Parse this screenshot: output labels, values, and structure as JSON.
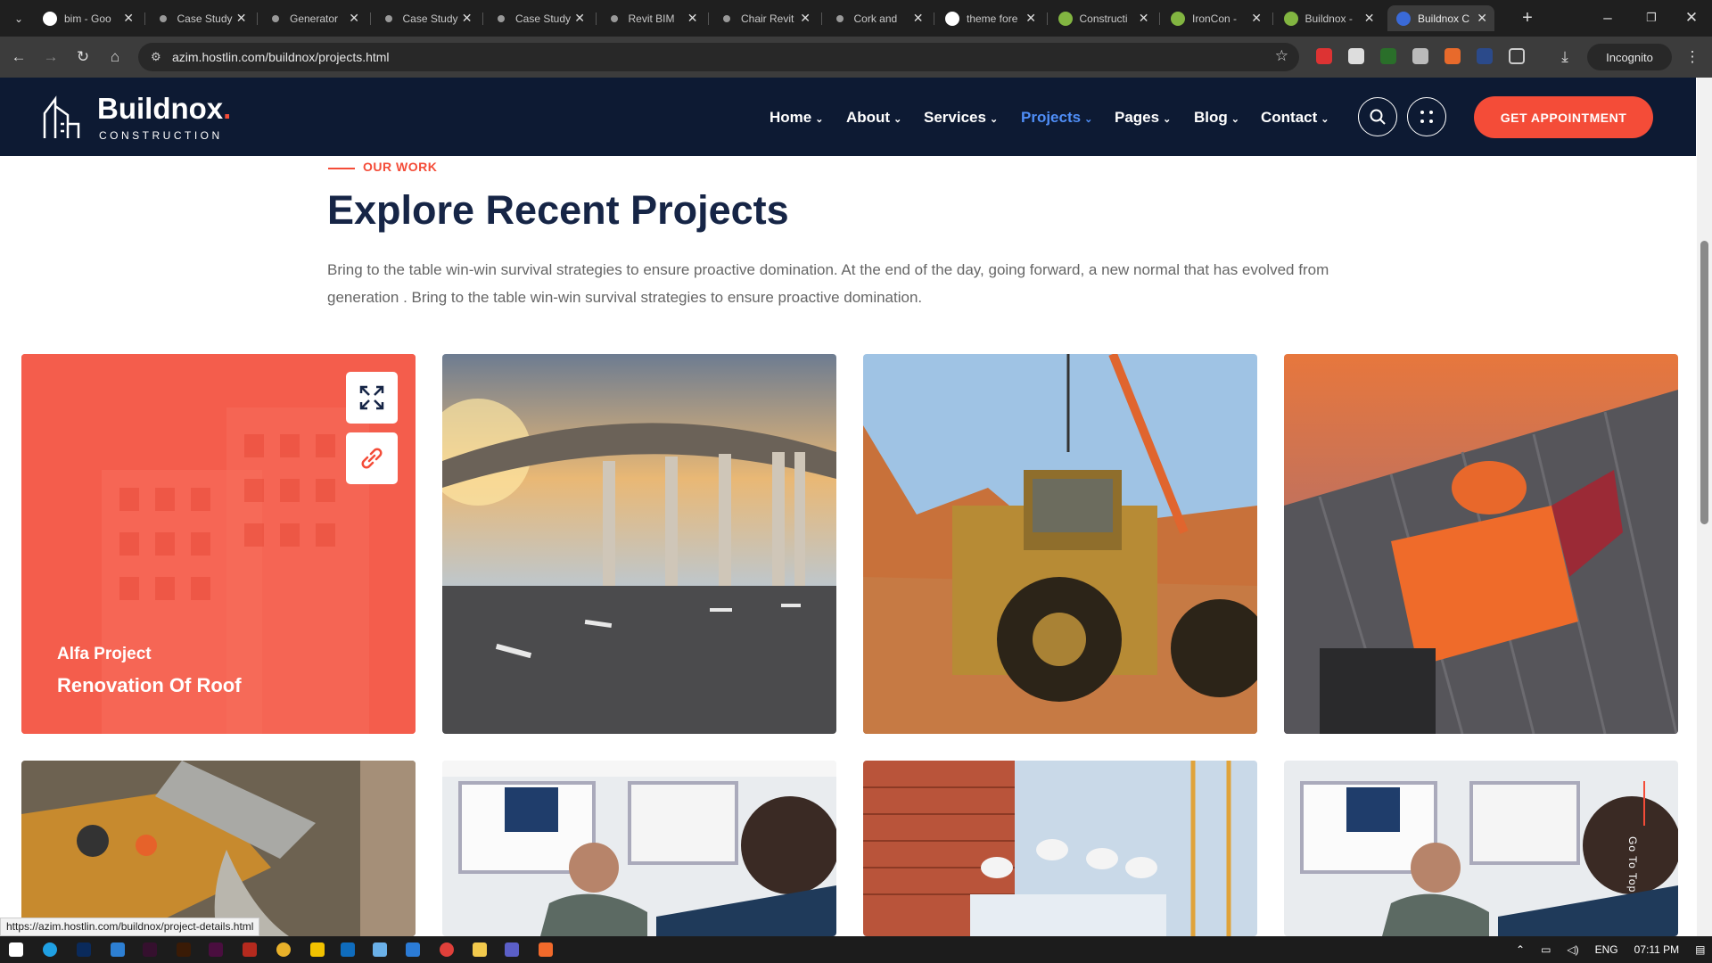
{
  "browser": {
    "tabs": [
      {
        "title": "bim - Goo",
        "favicon": "google-icon"
      },
      {
        "title": "Case Study",
        "favicon": "page-icon"
      },
      {
        "title": "Generator",
        "favicon": "page-icon"
      },
      {
        "title": "Case Study",
        "favicon": "page-icon"
      },
      {
        "title": "Case Study",
        "favicon": "page-icon"
      },
      {
        "title": "Revit BIM",
        "favicon": "page-icon"
      },
      {
        "title": "Chair Revit",
        "favicon": "page-icon"
      },
      {
        "title": "Cork and",
        "favicon": "page-icon"
      },
      {
        "title": "theme fore",
        "favicon": "google-icon"
      },
      {
        "title": "Constructi",
        "favicon": "envato-icon"
      },
      {
        "title": "IronCon -",
        "favicon": "envato-icon"
      },
      {
        "title": "Buildnox -",
        "favicon": "envato-icon"
      },
      {
        "title": "Buildnox C",
        "favicon": "buildnox-icon",
        "active": true
      }
    ],
    "url": "azim.hostlin.com/buildnox/projects.html",
    "incognito_label": "Incognito",
    "status_url": "https://azim.hostlin.com/buildnox/project-details.html"
  },
  "site": {
    "logo": {
      "name": "Buildnox",
      "sub": "CONSTRUCTION"
    },
    "nav": [
      {
        "label": "Home"
      },
      {
        "label": "About"
      },
      {
        "label": "Services"
      },
      {
        "label": "Projects",
        "active": true
      },
      {
        "label": "Pages"
      },
      {
        "label": "Blog"
      },
      {
        "label": "Contact"
      }
    ],
    "cta": "GET APPOINTMENT",
    "accent": "#f44c38",
    "header_bg": "#0d1a33",
    "active_nav_color": "#4f8ef7"
  },
  "section": {
    "eyebrow": "OUR WORK",
    "heading": "Explore Recent Projects",
    "description": "Bring to the table win-win survival strategies to ensure proactive domination. At the end of the day, going forward, a new normal that has evolved from generation . Bring to the table win-win survival strategies to ensure proactive domination."
  },
  "projects": [
    {
      "category": "Alfa Project",
      "title": "Renovation Of Roof"
    }
  ],
  "go_to_top": "Go To Top",
  "taskbar": {
    "language": "ENG",
    "time": "07:11 PM"
  }
}
